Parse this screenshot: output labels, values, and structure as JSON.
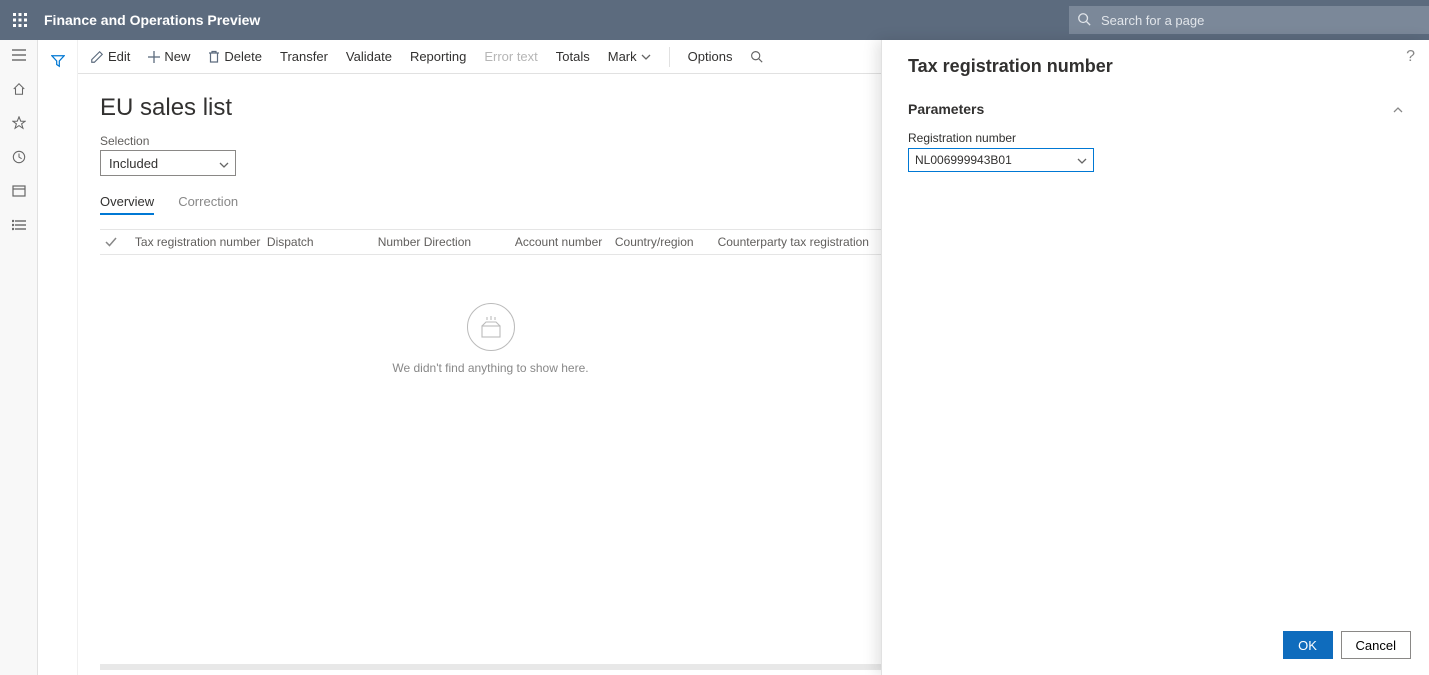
{
  "header": {
    "app_title": "Finance and Operations Preview",
    "search_placeholder": "Search for a page"
  },
  "actionbar": {
    "edit": "Edit",
    "new": "New",
    "delete": "Delete",
    "transfer": "Transfer",
    "validate": "Validate",
    "reporting": "Reporting",
    "error_text": "Error text",
    "totals": "Totals",
    "mark": "Mark",
    "options": "Options"
  },
  "page": {
    "title": "EU sales list",
    "selection_label": "Selection",
    "selection_value": "Included",
    "tabs": {
      "overview": "Overview",
      "correction": "Correction"
    },
    "grid": {
      "headers": {
        "tax_reg": "Tax registration number",
        "dispatch": "Dispatch",
        "number": "Number",
        "direction": "Direction",
        "account": "Account number",
        "country": "Country/region",
        "counterparty": "Counterparty tax registration"
      },
      "empty_msg": "We didn't find anything to show here."
    }
  },
  "panel": {
    "title": "Tax registration number",
    "section": "Parameters",
    "field_label": "Registration number",
    "field_value": "NL006999943B01",
    "ok": "OK",
    "cancel": "Cancel"
  }
}
